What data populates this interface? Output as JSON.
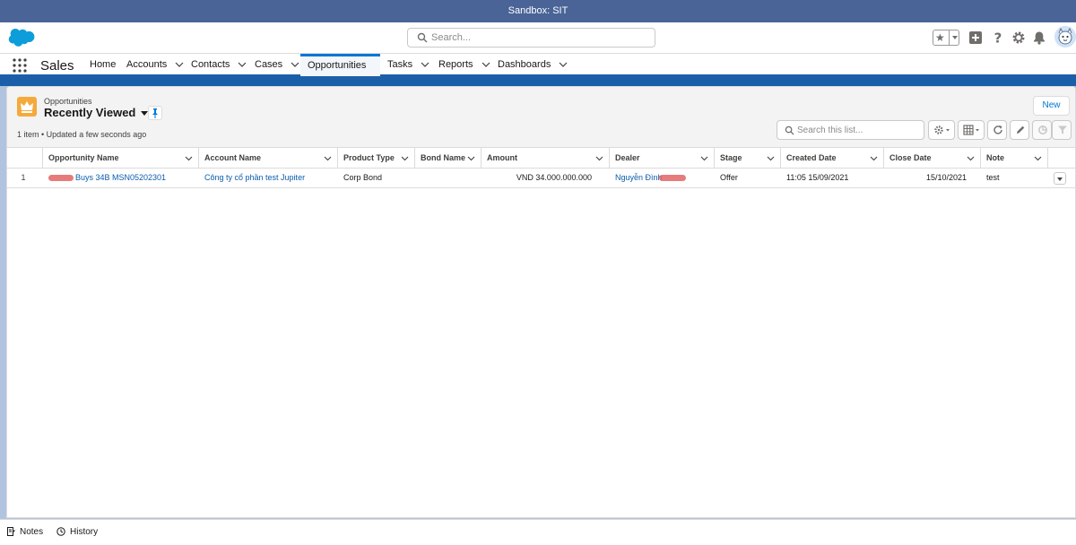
{
  "sandbox_label": "Sandbox: SIT",
  "global_search": {
    "placeholder": "Search..."
  },
  "app_name": "Sales",
  "nav": {
    "home": "Home",
    "accounts": "Accounts",
    "contacts": "Contacts",
    "cases": "Cases",
    "opportunities": "Opportunities",
    "tasks": "Tasks",
    "reports": "Reports",
    "dashboards": "Dashboards",
    "active": "Opportunities"
  },
  "list_view": {
    "object_label": "Opportunities",
    "view_name": "Recently Viewed",
    "meta": "1 item • Updated a few seconds ago",
    "new_button": "New",
    "search_placeholder": "Search this list..."
  },
  "table": {
    "columns": [
      "Opportunity Name",
      "Account Name",
      "Product Type",
      "Bond Name",
      "Amount",
      "Dealer",
      "Stage",
      "Created Date",
      "Close Date",
      "Note"
    ],
    "rows": [
      {
        "num": "1",
        "opportunity_name": "Buys 34B MSN05202301",
        "account_name": "Công ty cổ phần test Jupiter",
        "product_type": "Corp Bond",
        "bond_name": "",
        "amount": "VND 34.000.000.000",
        "dealer": "Nguyễn Đình",
        "stage": "Offer",
        "created_date": "11:05 15/09/2021",
        "close_date": "15/10/2021",
        "note": "test"
      }
    ]
  },
  "utility_bar": {
    "notes": "Notes",
    "history": "History"
  },
  "colors": {
    "sandbox_bar": "#4a6497",
    "brand_blue": "#0176d3",
    "link": "#0b5cab",
    "object_icon": "#f5a93b"
  }
}
